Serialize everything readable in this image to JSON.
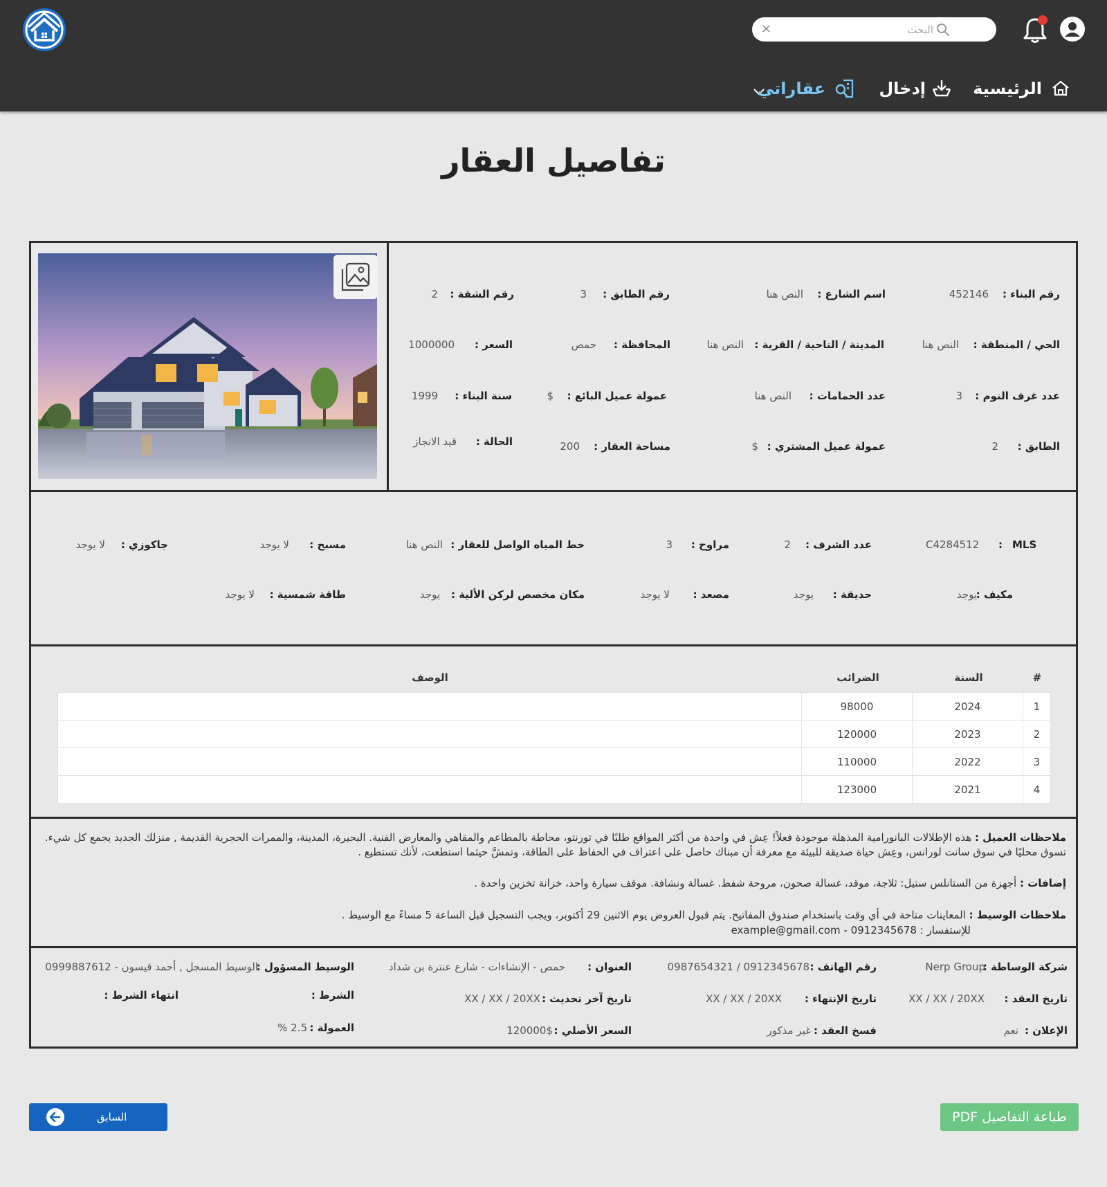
{
  "header": {
    "search_placeholder": "البحث",
    "clear_glyph": "×",
    "nav": {
      "home": "الرئيسية",
      "entry": "إدخال",
      "my_properties": "عقاراتي"
    }
  },
  "page_title": "تفاصيل العقار",
  "info": {
    "building_no": {
      "label": "رقم البناء :",
      "value": "452146"
    },
    "street_name": {
      "label": "اسم الشارع :",
      "value": "النص هنا"
    },
    "floor_no": {
      "label": "رقم الطابق :",
      "value": "3"
    },
    "apartment_no": {
      "label": "رقم الشقة :",
      "value": "2"
    },
    "district": {
      "label": "الحي / المنطقة :",
      "value": "النص هنا"
    },
    "city": {
      "label": "المدينة / الناحية / القرية :",
      "value": "النص هنا"
    },
    "governorate": {
      "label": "المحافظة :",
      "value": "حمص"
    },
    "price": {
      "label": "السعر :",
      "value": "1000000"
    },
    "bedrooms": {
      "label": "عدد غرف النوم :",
      "value": "3"
    },
    "bathrooms": {
      "label": "عدد الحمامات :",
      "value": "النص هنا"
    },
    "seller_commission": {
      "label": "عمولة عميل البائع :",
      "value": "$"
    },
    "build_year": {
      "label": "سنة البناء :",
      "value": "1999"
    },
    "floor": {
      "label": "الطابق :",
      "value": "2"
    },
    "buyer_commission": {
      "label": "عمولة عميل المشتري :",
      "value": "$"
    },
    "area": {
      "label": "مساحة العقار :",
      "value": "200"
    },
    "status": {
      "label": "الحالة :",
      "value": "قيد الانجاز"
    }
  },
  "features": {
    "mls": {
      "label": "MLS",
      "sep": ":",
      "value": "C4284512"
    },
    "balconies": {
      "label": "عدد الشرف :",
      "value": "2"
    },
    "fans": {
      "label": "مراوح :",
      "value": "3"
    },
    "water_line": {
      "label": "خط المياه الواصل للعقار :",
      "value": "النص هنا"
    },
    "pool": {
      "label": "مسبح :",
      "value": "لا يوجد"
    },
    "jacuzzi": {
      "label": "جاكوزي :",
      "value": "لا يوجد"
    },
    "ac": {
      "label": "مكيف :",
      "value": "يوجد"
    },
    "garden": {
      "label": "حديقة :",
      "value": "يوجد"
    },
    "elevator": {
      "label": "مصعد :",
      "value": "لا يوجد"
    },
    "parking": {
      "label": "مكان مخصص لركن الألية :",
      "value": "يوجد"
    },
    "solar": {
      "label": "طاقة شمسية :",
      "value": "لا يوجد"
    }
  },
  "tax_table": {
    "headers": {
      "num": "#",
      "year": "السنة",
      "tax": "الضرائب",
      "desc": "الوصف"
    },
    "rows": [
      {
        "num": "1",
        "year": "2024",
        "tax": "98000",
        "desc": ""
      },
      {
        "num": "2",
        "year": "2023",
        "tax": "120000",
        "desc": ""
      },
      {
        "num": "3",
        "year": "2022",
        "tax": "110000",
        "desc": ""
      },
      {
        "num": "4",
        "year": "2021",
        "tax": "123000",
        "desc": ""
      }
    ]
  },
  "notes": {
    "client": {
      "label": "ملاحظات العميل :",
      "text": "هذه الإطلالات البانورامية المذهلة موجودة فعلاً! عِش في واحدة من أكثر المواقع طلبًا في تورنتو، محاطة بالمطاعم والمقاهي والمعارض الفنية. البحيرة، المدينة، والممرات الحجرية القديمة , منزلك الجديد يجمع كل شيء. تسوق محليًا في سوق سانت لورانس، وعِش حياة صديقة للبيئة مع معرفة أن مبناك حاصل على اعتراف في الحفاظ على الطاقة، وتمشَّ حيثما استطعت، لأنك تستطيع ."
    },
    "extras": {
      "label": "إضافات :",
      "text": "أجهزة من الستانلس ستيل: ثلاجة، موقد، غسالة صحون، مروحة شفط. غسالة ونشافة. موقف سيارة واحد، خزانة تخزين واحدة ."
    },
    "broker": {
      "label": "ملاحظات الوسيط :",
      "text": "المعاينات متاحة في أي وقت باستخدام صندوق المفاتيح. يتم قبول العروض يوم الاثنين 29 أكتوبر، ويجب التسجيل قبل الساعة 5 مساءً مع الوسيط .",
      "inquiry": "للإستفسار : 0912345678 - example@gmail.com"
    }
  },
  "contract": {
    "agency": {
      "label": "شركة الوساطة :",
      "value": "Nerp Group"
    },
    "phone": {
      "label": "رقم الهاتف :",
      "value": "0912345678 / 0987654321"
    },
    "address": {
      "label": "العنوان :",
      "value": "حمص - الإنشاءات - شارع عنترة بن شداد"
    },
    "agent": {
      "label": "الوسيط المسؤول :",
      "value": "الوسيط المسجل , أحمد قيسون - 0999887612"
    },
    "contract_date": {
      "label": "تاريخ العقد :",
      "value": "XX / XX / 20XX"
    },
    "end_date": {
      "label": "تاريخ الإنتهاء :",
      "value": "XX / XX / 20XX"
    },
    "last_update": {
      "label": "تاريخ آخر تحديث :",
      "value": "XX / XX / 20XX"
    },
    "condition": {
      "label": "الشرط :",
      "value": ""
    },
    "condition_end": {
      "label": "انتهاء الشرط :",
      "value": ""
    },
    "ad": {
      "label": "الإعلان :",
      "value": "نعم"
    },
    "cancel": {
      "label": "فسخ العقد :",
      "value": "غير مذكور"
    },
    "original_price": {
      "label": "السعر الأصلي :",
      "value": "120000$"
    },
    "commission": {
      "label": "العمولة :",
      "value": "2.5 %"
    }
  },
  "buttons": {
    "previous": "السابق",
    "print_pdf": "طباعة التفاصيل PDF"
  },
  "colors": {
    "header_bg": "#333333",
    "active_nav": "#7cc4f2",
    "notification_dot": "#e53935",
    "prev_button": "#1565c0",
    "pdf_button": "#6cc785",
    "logo_blue": "#1e6fc2"
  },
  "icons": {
    "logo": "house-logo-icon",
    "avatar": "user-circle-icon",
    "bell": "bell-icon",
    "search": "search-icon",
    "home": "home-icon",
    "entry": "download-tray-icon",
    "my_properties": "property-search-icon",
    "gallery": "gallery-icon",
    "back": "arrow-left-circle-icon"
  }
}
